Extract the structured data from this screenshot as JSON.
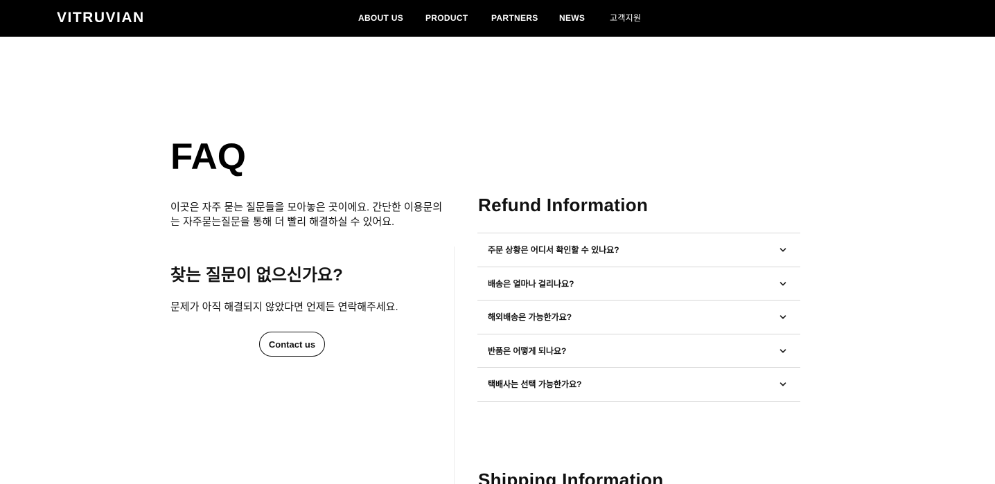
{
  "header": {
    "logo": "VITRUVIAN",
    "nav": [
      "ABOUT US",
      "PRODUCT",
      "PARTNERS",
      "NEWS",
      "고객지원"
    ]
  },
  "faq": {
    "title": "FAQ",
    "intro": "이곳은 자주 묻는 질문들을 모아놓은 곳이에요. 간단한 이용문의는 자주묻는질문을 통해 더 빨리 해결하실 수 있어요.",
    "no_find_title": "찾는 질문이 없으신가요?",
    "no_find_sub": "문제가 아직 해결되지 않았다면 언제든 연락해주세요.",
    "contact_label": "Contact us"
  },
  "refund": {
    "title": "Refund Information",
    "questions": [
      "주문 상황은 어디서 확인할 수 있나요?",
      "배송은 얼마나 걸리나요?",
      "해외배송은 가능한가요?",
      "반품은 어떻게 되나요?",
      "택배사는 선택 가능한가요?"
    ]
  },
  "shipping": {
    "title": "Shipping Information"
  },
  "icons": {
    "expand": "chevron-down-icon"
  }
}
